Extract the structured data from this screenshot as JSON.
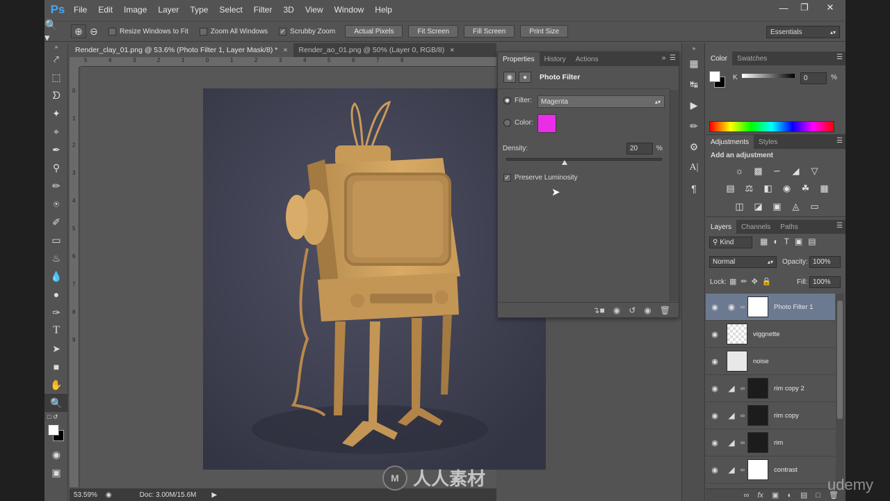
{
  "menubar": {
    "logo": "Ps",
    "items": [
      "File",
      "Edit",
      "Image",
      "Layer",
      "Type",
      "Select",
      "Filter",
      "3D",
      "View",
      "Window",
      "Help"
    ]
  },
  "options_bar": {
    "checks": [
      {
        "label": "Resize Windows to Fit",
        "checked": false
      },
      {
        "label": "Zoom All Windows",
        "checked": false
      },
      {
        "label": "Scrubby Zoom",
        "checked": true
      }
    ],
    "buttons": [
      "Actual Pixels",
      "Fit Screen",
      "Fill Screen",
      "Print Size"
    ],
    "workspace": "Essentials"
  },
  "documents": {
    "tabs": [
      {
        "label": "Render_clay_01.png @ 53.6% (Photo Filter 1, Layer Mask/8) *",
        "active": true
      },
      {
        "label": "Render_ao_01.png @ 50% (Layer 0, RGB/8)",
        "active": false
      }
    ],
    "ruler_h": [
      "5",
      "4",
      "3",
      "2",
      "1",
      "0",
      "1",
      "2",
      "3",
      "4",
      "5",
      "6",
      "7",
      "8"
    ],
    "ruler_v": [
      "0",
      "1",
      "2",
      "3",
      "4",
      "5",
      "6",
      "7",
      "8",
      "9"
    ]
  },
  "status": {
    "zoom": "53.59%",
    "doc": "Doc: 3.00M/15.6M"
  },
  "properties": {
    "tabs": [
      "Properties",
      "History",
      "Actions"
    ],
    "title": "Photo Filter",
    "filter_label": "Filter:",
    "filter_value": "Magenta",
    "color_label": "Color:",
    "color_swatch": "#ea2ee8",
    "density_label": "Density:",
    "density_value": "20",
    "density_unit": "%",
    "density_fraction": 0.2,
    "preserve_label": "Preserve Luminosity",
    "preserve_checked": true
  },
  "color_panel": {
    "tabs": [
      "Color",
      "Swatches"
    ],
    "channel_label": "K",
    "value": "0",
    "unit": "%"
  },
  "adjustments": {
    "tabs": [
      "Adjustments",
      "Styles"
    ],
    "heading": "Add an adjustment"
  },
  "layers_panel": {
    "tabs": [
      "Layers",
      "Channels",
      "Paths"
    ],
    "filter_kind": "Kind",
    "blend_mode": "Normal",
    "opacity_label": "Opacity:",
    "opacity_value": "100%",
    "lock_label": "Lock:",
    "fill_label": "Fill:",
    "fill_value": "100%",
    "layers": [
      {
        "name": "Photo Filter 1",
        "selected": true
      },
      {
        "name": "viggnette",
        "selected": false
      },
      {
        "name": "noise",
        "selected": false
      },
      {
        "name": "rim copy 2",
        "selected": false
      },
      {
        "name": "rim copy",
        "selected": false
      },
      {
        "name": "rim",
        "selected": false
      },
      {
        "name": "contrast",
        "selected": false
      }
    ]
  },
  "watermark": {
    "udemy": "udemy",
    "cn_logo": "人人素材"
  }
}
